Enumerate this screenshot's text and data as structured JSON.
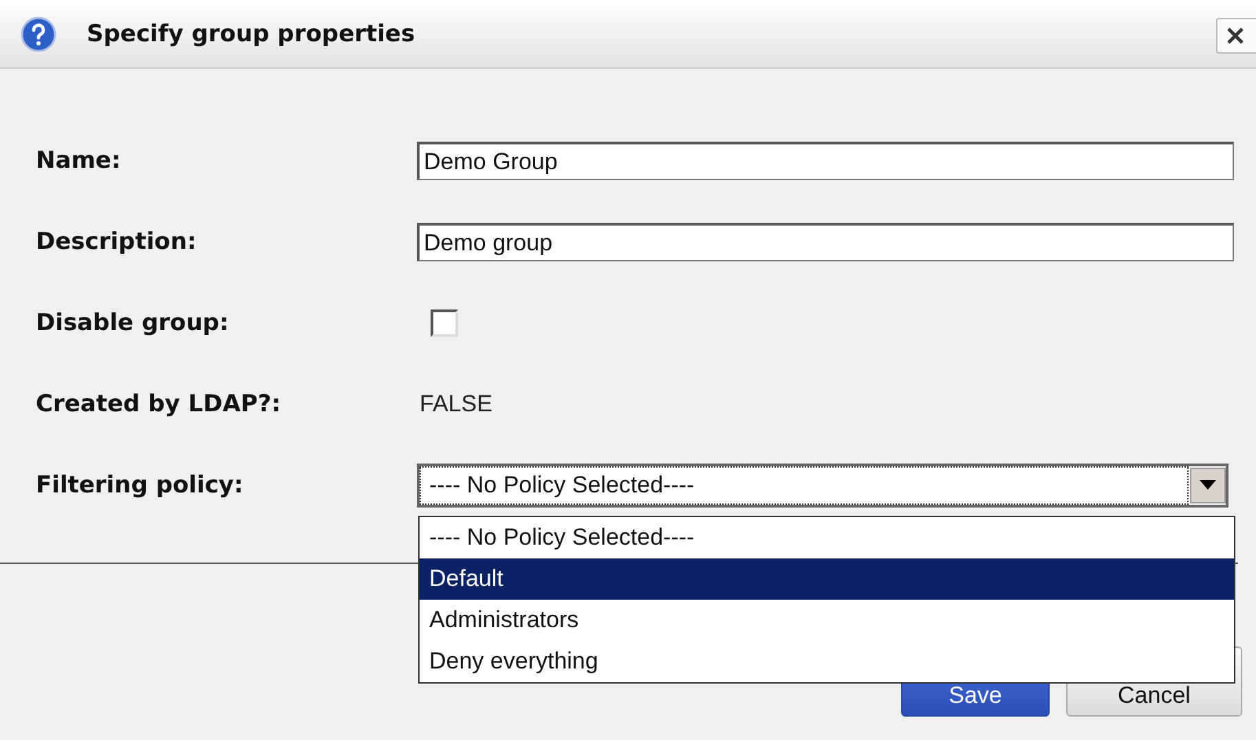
{
  "window": {
    "title": "Specify group properties"
  },
  "fields": [
    {
      "kind": "text",
      "label": "Name:",
      "value": "Demo Group"
    },
    {
      "kind": "text",
      "label": "Description:",
      "value": "Demo group"
    },
    {
      "kind": "checkbox",
      "label": "Disable group:",
      "checked": false
    },
    {
      "kind": "static",
      "label": "Created by LDAP?:",
      "value": "FALSE"
    },
    {
      "kind": "select",
      "label": "Filtering policy:",
      "value": "---- No Policy Selected----",
      "expanded": true,
      "options": [
        {
          "label": "---- No Policy Selected----",
          "highlighted": false
        },
        {
          "label": "Default",
          "highlighted": true
        },
        {
          "label": "Administrators",
          "highlighted": false
        },
        {
          "label": "Deny everything",
          "highlighted": false
        }
      ]
    }
  ],
  "buttons": [
    {
      "kind": "primary",
      "label": "Save"
    },
    {
      "kind": "secondary",
      "label": "Cancel"
    }
  ]
}
